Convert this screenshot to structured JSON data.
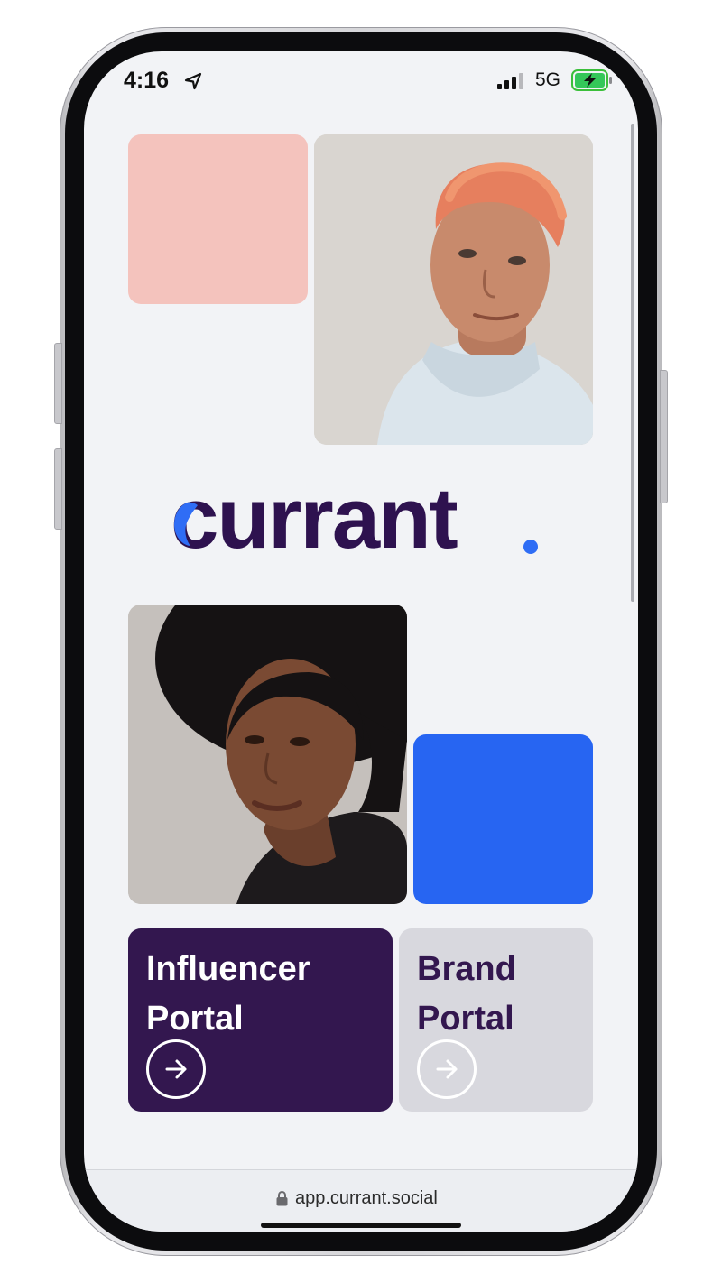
{
  "status_bar": {
    "time": "4:16",
    "network": "5G",
    "icons": [
      "location-arrow-icon",
      "cellular-signal-icon",
      "battery-charging-icon"
    ]
  },
  "brand": {
    "logo_text": "currant",
    "colors": {
      "primary": "#2e124f",
      "accent_blue": "#2765f2",
      "accent_pink": "#f4c3bd"
    }
  },
  "portals": [
    {
      "line1": "Influencer",
      "line2": "Portal",
      "icon": "arrow-right-icon"
    },
    {
      "line1": "Brand",
      "line2": "Portal",
      "icon": "arrow-right-icon"
    }
  ],
  "address_bar": {
    "url": "app.currant.social",
    "icon": "lock-icon"
  }
}
